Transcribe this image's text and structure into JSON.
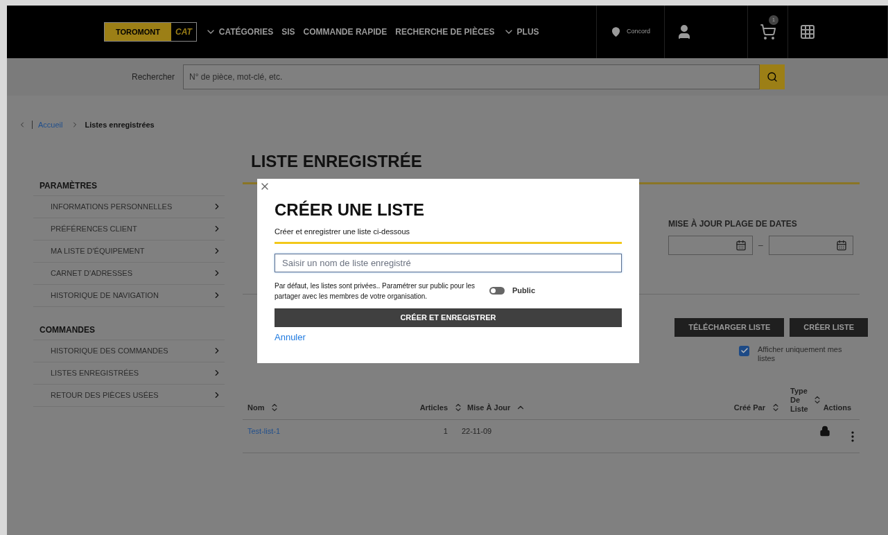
{
  "header": {
    "logo": {
      "brand": "TOROMONT",
      "mark": "CAT"
    },
    "nav": [
      {
        "label": "CATÉGORIES",
        "caret": true
      },
      {
        "label": "SIS",
        "caret": false
      },
      {
        "label": "COMMANDE RAPIDE",
        "caret": false
      },
      {
        "label": "RECHERCHE DE PIÈCES",
        "caret": false
      },
      {
        "label": "PLUS",
        "caret": true
      }
    ],
    "location": "Concord",
    "cart_count": "1"
  },
  "search": {
    "label": "Rechercher",
    "placeholder": "N° de pièce, mot-clé, etc."
  },
  "breadcrumb": [
    "Accueil",
    "Listes enregistrées"
  ],
  "sidebar": [
    {
      "title": "PARAMÈTRES",
      "items": [
        "INFORMATIONS PERSONNELLES",
        "PRÉFÉRENCES CLIENT",
        "MA LISTE D'ÉQUIPEMENT",
        "CARNET D'ADRESSES",
        "HISTORIQUE DE NAVIGATION"
      ]
    },
    {
      "title": "COMMANDES",
      "items": [
        "HISTORIQUE DES COMMANDES",
        "LISTES ENREGISTRÉES",
        "RETOUR DES PIÈCES USÉES"
      ]
    }
  ],
  "main": {
    "title": "LISTE ENREGISTRÉE",
    "date_range_label": "MISE À JOUR PLAGE DE DATES",
    "date_separator": "–",
    "buttons": [
      "TÉLÉCHARGER LISTE",
      "CRÉER LISTE"
    ],
    "only_mine": {
      "label": "Afficher uniquement mes listes",
      "checked": true
    },
    "columns": [
      {
        "label": "Nom",
        "sortable": true,
        "ascending": false
      },
      {
        "label": "Articles",
        "sortable": true,
        "ascending": false
      },
      {
        "label": "Mise À Jour",
        "sortable": true,
        "ascending": true
      },
      {
        "label": "Créé Par",
        "sortable": true,
        "ascending": false
      },
      {
        "label": "Type De Liste",
        "sortable": true,
        "ascending": false
      },
      {
        "label": "Actions",
        "sortable": false
      }
    ],
    "rows": [
      {
        "name": "Test-list-1",
        "articles": "1",
        "updated": "22-11-09",
        "private": true
      }
    ]
  },
  "modal": {
    "title": "CRÉER UNE LISTE",
    "subtitle": "Créer et enregistrer une liste ci-dessous",
    "placeholder": "Saisir un nom de liste enregistré",
    "note": "Par défaut, les listes sont privées.. Paramétrer sur public pour les partager avec les membres de votre organisation.",
    "toggle": {
      "label": "Public",
      "on": false
    },
    "submit": "CRÉER ET ENREGISTRER",
    "cancel": "Annuler"
  }
}
